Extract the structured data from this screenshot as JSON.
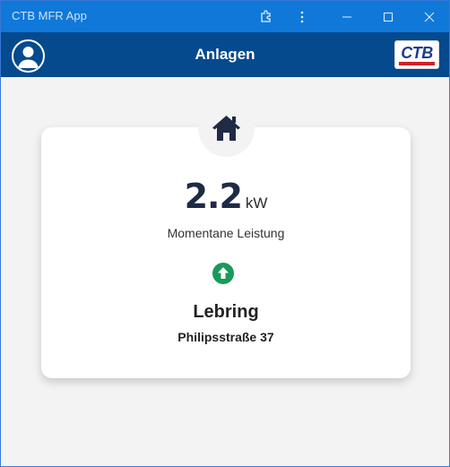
{
  "window": {
    "title": "CTB MFR App"
  },
  "header": {
    "title": "Anlagen",
    "logo_text": "CTB"
  },
  "card": {
    "power_value": "2.2",
    "power_unit": "kW",
    "power_label": "Momentane Leistung",
    "site_name": "Lebring",
    "site_address": "Philipsstraße 37"
  },
  "icons": {
    "extension": "puzzle-icon",
    "more": "more-vertical-icon",
    "minimize": "minimize-icon",
    "maximize": "maximize-icon",
    "close": "close-icon",
    "profile": "user-icon",
    "home": "home-icon",
    "status": "arrow-up-circle-icon"
  },
  "colors": {
    "titlebar": "#0f78d9",
    "appbar": "#054a8d",
    "accent_green": "#1a9a5a",
    "value_text": "#1f2a44"
  }
}
